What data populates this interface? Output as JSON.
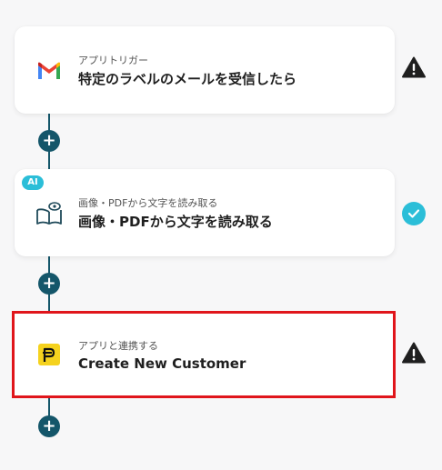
{
  "steps": [
    {
      "subtitle": "アプリトリガー",
      "title": "特定のラベルのメールを受信したら",
      "app_icon": "gmail-icon",
      "status": "warning"
    },
    {
      "badge": "AI",
      "subtitle": "画像・PDFから文字を読み取る",
      "title": "画像・PDFから文字を読み取る",
      "app_icon": "ocr-book-eye-icon",
      "status": "complete"
    },
    {
      "subtitle": "アプリと連携する",
      "title": "Create New Customer",
      "app_icon": "yoom-p-logo-icon",
      "status": "warning",
      "selected": true
    }
  ],
  "add_button": {
    "label": "+"
  },
  "colors": {
    "connector": "#14566a",
    "ai_accent": "#2bbed8",
    "selection": "#e0151b",
    "warning": "#1f1f1f",
    "yoom_yellow": "#f5d21e"
  }
}
